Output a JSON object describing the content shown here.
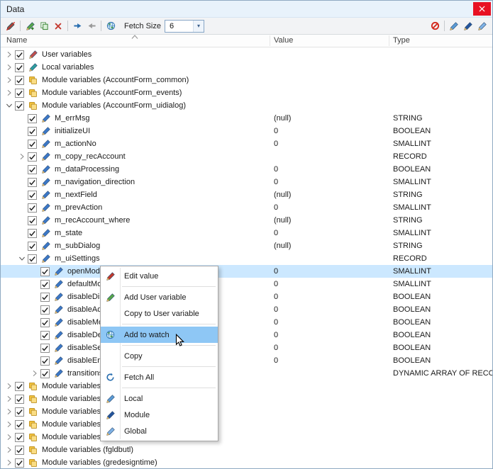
{
  "window": {
    "title": "Data"
  },
  "toolbar": {
    "left": [
      {
        "t": "icon",
        "name": "pen-slash-icon"
      },
      {
        "t": "sep"
      },
      {
        "t": "icon",
        "name": "add-variable-icon"
      },
      {
        "t": "icon",
        "name": "copy-variable-icon"
      },
      {
        "t": "icon",
        "name": "remove-variable-icon"
      },
      {
        "t": "sep"
      },
      {
        "t": "icon",
        "name": "forward-arrow-icon"
      },
      {
        "t": "icon",
        "name": "back-arrow-icon"
      },
      {
        "t": "sep"
      },
      {
        "t": "icon",
        "name": "watch-globe-icon"
      },
      {
        "t": "label",
        "text": "Fetch Size"
      },
      {
        "t": "combo",
        "value": "6"
      }
    ],
    "right": [
      {
        "t": "icon",
        "name": "red-ban-icon"
      },
      {
        "t": "sep"
      },
      {
        "t": "icon",
        "name": "local-pen-icon"
      },
      {
        "t": "icon",
        "name": "module-pen-icon"
      },
      {
        "t": "icon",
        "name": "global-pen-icon"
      }
    ]
  },
  "header": {
    "columns": [
      "Name",
      "Value",
      "Type"
    ]
  },
  "tree": {
    "rows": [
      {
        "level": 0,
        "expander": "collapsed",
        "checked": true,
        "icon": "user-variables-icon",
        "name": "User variables",
        "value": "",
        "type": ""
      },
      {
        "level": 0,
        "expander": "collapsed",
        "checked": true,
        "icon": "local-variables-icon",
        "name": "Local variables",
        "value": "",
        "type": ""
      },
      {
        "level": 0,
        "expander": "collapsed",
        "checked": true,
        "icon": "module-variables-icon",
        "name": "Module variables (AccountForm_common)",
        "value": "",
        "type": ""
      },
      {
        "level": 0,
        "expander": "collapsed",
        "checked": true,
        "icon": "module-variables-icon",
        "name": "Module variables (AccountForm_events)",
        "value": "",
        "type": ""
      },
      {
        "level": 0,
        "expander": "expanded",
        "checked": true,
        "icon": "module-variables-icon",
        "name": "Module variables (AccountForm_uidialog)",
        "value": "",
        "type": ""
      },
      {
        "level": 1,
        "expander": "none",
        "checked": true,
        "icon": "variable-pen-icon",
        "name": "M_errMsg",
        "value": "(null)",
        "type": "STRING"
      },
      {
        "level": 1,
        "expander": "none",
        "checked": true,
        "icon": "variable-pen-icon",
        "name": "initializeUI",
        "value": "0",
        "type": "BOOLEAN"
      },
      {
        "level": 1,
        "expander": "none",
        "checked": true,
        "icon": "variable-pen-icon",
        "name": "m_actionNo",
        "value": "0",
        "type": "SMALLINT"
      },
      {
        "level": 1,
        "expander": "collapsed",
        "checked": true,
        "icon": "variable-pen-icon",
        "name": "m_copy_recAccount",
        "value": "",
        "type": "RECORD"
      },
      {
        "level": 1,
        "expander": "none",
        "checked": true,
        "icon": "variable-pen-icon",
        "name": "m_dataProcessing",
        "value": "0",
        "type": "BOOLEAN"
      },
      {
        "level": 1,
        "expander": "none",
        "checked": true,
        "icon": "variable-pen-icon",
        "name": "m_navigation_direction",
        "value": "0",
        "type": "SMALLINT"
      },
      {
        "level": 1,
        "expander": "none",
        "checked": true,
        "icon": "variable-pen-icon",
        "name": "m_nextField",
        "value": "(null)",
        "type": "STRING"
      },
      {
        "level": 1,
        "expander": "none",
        "checked": true,
        "icon": "variable-pen-icon",
        "name": "m_prevAction",
        "value": "0",
        "type": "SMALLINT"
      },
      {
        "level": 1,
        "expander": "none",
        "checked": true,
        "icon": "variable-pen-icon",
        "name": "m_recAccount_where",
        "value": "(null)",
        "type": "STRING"
      },
      {
        "level": 1,
        "expander": "none",
        "checked": true,
        "icon": "variable-pen-icon",
        "name": "m_state",
        "value": "0",
        "type": "SMALLINT"
      },
      {
        "level": 1,
        "expander": "none",
        "checked": true,
        "icon": "variable-pen-icon",
        "name": "m_subDialog",
        "value": "(null)",
        "type": "STRING"
      },
      {
        "level": 1,
        "expander": "expanded",
        "checked": true,
        "icon": "variable-pen-icon",
        "name": "m_uiSettings",
        "value": "",
        "type": "RECORD"
      },
      {
        "level": 2,
        "expander": "none",
        "checked": true,
        "icon": "variable-pen-icon",
        "name": "openMode",
        "value": "0",
        "type": "SMALLINT",
        "selected": true
      },
      {
        "level": 2,
        "expander": "none",
        "checked": true,
        "icon": "variable-pen-icon",
        "name": "defaultMode",
        "value": "0",
        "type": "SMALLINT"
      },
      {
        "level": 2,
        "expander": "none",
        "checked": true,
        "icon": "variable-pen-icon",
        "name": "disableDisplay",
        "value": "0",
        "type": "BOOLEAN"
      },
      {
        "level": 2,
        "expander": "none",
        "checked": true,
        "icon": "variable-pen-icon",
        "name": "disableAdd",
        "value": "0",
        "type": "BOOLEAN"
      },
      {
        "level": 2,
        "expander": "none",
        "checked": true,
        "icon": "variable-pen-icon",
        "name": "disableModify",
        "value": "0",
        "type": "BOOLEAN"
      },
      {
        "level": 2,
        "expander": "none",
        "checked": true,
        "icon": "variable-pen-icon",
        "name": "disableDelete",
        "value": "0",
        "type": "BOOLEAN"
      },
      {
        "level": 2,
        "expander": "none",
        "checked": true,
        "icon": "variable-pen-icon",
        "name": "disableSearch",
        "value": "0",
        "type": "BOOLEAN"
      },
      {
        "level": 2,
        "expander": "none",
        "checked": true,
        "icon": "variable-pen-icon",
        "name": "disableEmpty",
        "value": "0",
        "type": "BOOLEAN"
      },
      {
        "level": 2,
        "expander": "collapsed",
        "checked": true,
        "icon": "variable-pen-icon",
        "name": "transitions",
        "value": "",
        "type": "DYNAMIC ARRAY OF RECO"
      },
      {
        "level": 0,
        "expander": "collapsed",
        "checked": true,
        "icon": "module-variables-icon",
        "name": "Module variables",
        "value": "",
        "type": ""
      },
      {
        "level": 0,
        "expander": "collapsed",
        "checked": true,
        "icon": "module-variables-icon",
        "name": "Module variables",
        "value": "",
        "type": ""
      },
      {
        "level": 0,
        "expander": "collapsed",
        "checked": true,
        "icon": "module-variables-icon",
        "name": "Module variables",
        "value": "",
        "type": ""
      },
      {
        "level": 0,
        "expander": "collapsed",
        "checked": true,
        "icon": "module-variables-icon",
        "name": "Module variables",
        "value": "",
        "type": ""
      },
      {
        "level": 0,
        "expander": "collapsed",
        "checked": true,
        "icon": "module-variables-icon",
        "name": "Module variables",
        "value": "",
        "type": ""
      },
      {
        "level": 0,
        "expander": "collapsed",
        "checked": true,
        "icon": "module-variables-icon",
        "name": "Module variables (fgldbutl)",
        "value": "",
        "type": ""
      },
      {
        "level": 0,
        "expander": "collapsed",
        "checked": true,
        "icon": "module-variables-icon",
        "name": "Module variables (gredesigntime)",
        "value": "",
        "type": ""
      }
    ]
  },
  "context_menu": {
    "items": [
      {
        "type": "item",
        "icon": "edit-pen-icon",
        "label": "Edit value"
      },
      {
        "type": "separator"
      },
      {
        "type": "item",
        "icon": "add-user-variable-icon",
        "label": "Add User variable"
      },
      {
        "type": "item",
        "icon": "",
        "label": "Copy to User variable"
      },
      {
        "type": "separator"
      },
      {
        "type": "item",
        "icon": "globe-icon",
        "label": "Add to watch",
        "highlighted": true
      },
      {
        "type": "separator"
      },
      {
        "type": "item",
        "icon": "",
        "label": "Copy"
      },
      {
        "type": "separator"
      },
      {
        "type": "item",
        "icon": "fetch-all-icon",
        "label": "Fetch All"
      },
      {
        "type": "separator"
      },
      {
        "type": "item",
        "icon": "local-pen-icon",
        "label": "Local"
      },
      {
        "type": "item",
        "icon": "module-pen-icon",
        "label": "Module"
      },
      {
        "type": "item",
        "icon": "global-pen-icon",
        "label": "Global"
      }
    ]
  },
  "colors": {
    "selection": "#cce8ff",
    "menu_highlight": "#8ec7f5",
    "close_button": "#e81123",
    "titlebar": "#e8f2fb",
    "accent_blue": "#3c78c8"
  }
}
